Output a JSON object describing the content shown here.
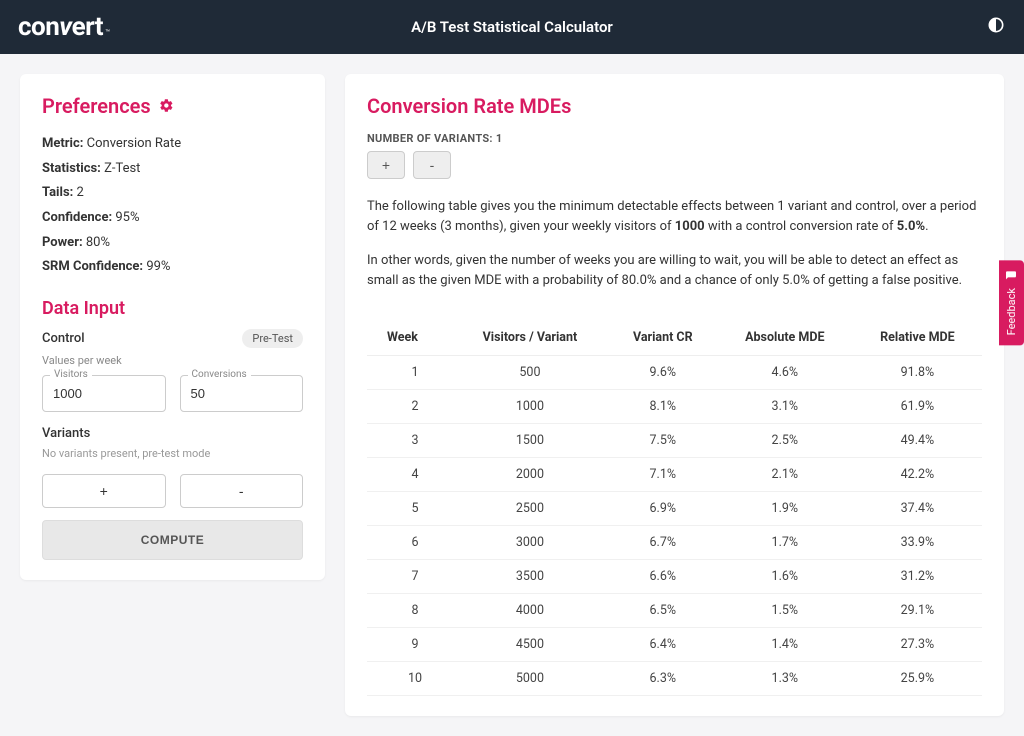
{
  "header": {
    "logo_main": "con",
    "logo_slash": "v",
    "logo_rest": "ert",
    "logo_tm": "™",
    "title": "A/B Test Statistical Calculator"
  },
  "preferences": {
    "title": "Preferences",
    "items": [
      {
        "label": "Metric:",
        "value": "Conversion Rate"
      },
      {
        "label": "Statistics:",
        "value": "Z-Test"
      },
      {
        "label": "Tails:",
        "value": "2"
      },
      {
        "label": "Confidence:",
        "value": "95%"
      },
      {
        "label": "Power:",
        "value": "80%"
      },
      {
        "label": "SRM Confidence:",
        "value": "99%"
      }
    ]
  },
  "data_input": {
    "title": "Data Input",
    "control_label": "Control",
    "pretest_badge": "Pre-Test",
    "values_hint": "Values per week",
    "visitors_label": "Visitors",
    "visitors_value": "1000",
    "conversions_label": "Conversions",
    "conversions_value": "50",
    "variants_label": "Variants",
    "variants_empty": "No variants present, pre-test mode",
    "add_label": "+",
    "remove_label": "-",
    "compute_label": "COMPUTE"
  },
  "main": {
    "title": "Conversion Rate MDEs",
    "num_variants_label": "NUMBER OF VARIANTS: 1",
    "add_label": "+",
    "remove_label": "-",
    "desc1_pre": "The following table gives you the minimum detectable effects between 1 variant and control, over a period of 12 weeks (3 months), given your weekly visitors of ",
    "desc1_b1": "1000",
    "desc1_mid": " with a control conversion rate of ",
    "desc1_b2": "5.0%",
    "desc1_post": ".",
    "desc2": "In other words, given the number of weeks you are willing to wait, you will be able to detect an effect as small as the given MDE with a probability of 80.0% and a chance of only 5.0% of getting a false positive.",
    "columns": [
      "Week",
      "Visitors / Variant",
      "Variant CR",
      "Absolute MDE",
      "Relative MDE"
    ],
    "rows": [
      [
        "1",
        "500",
        "9.6%",
        "4.6%",
        "91.8%"
      ],
      [
        "2",
        "1000",
        "8.1%",
        "3.1%",
        "61.9%"
      ],
      [
        "3",
        "1500",
        "7.5%",
        "2.5%",
        "49.4%"
      ],
      [
        "4",
        "2000",
        "7.1%",
        "2.1%",
        "42.2%"
      ],
      [
        "5",
        "2500",
        "6.9%",
        "1.9%",
        "37.4%"
      ],
      [
        "6",
        "3000",
        "6.7%",
        "1.7%",
        "33.9%"
      ],
      [
        "7",
        "3500",
        "6.6%",
        "1.6%",
        "31.2%"
      ],
      [
        "8",
        "4000",
        "6.5%",
        "1.5%",
        "29.1%"
      ],
      [
        "9",
        "4500",
        "6.4%",
        "1.4%",
        "27.3%"
      ],
      [
        "10",
        "5000",
        "6.3%",
        "1.3%",
        "25.9%"
      ]
    ]
  },
  "feedback": {
    "label": "Feedback"
  }
}
